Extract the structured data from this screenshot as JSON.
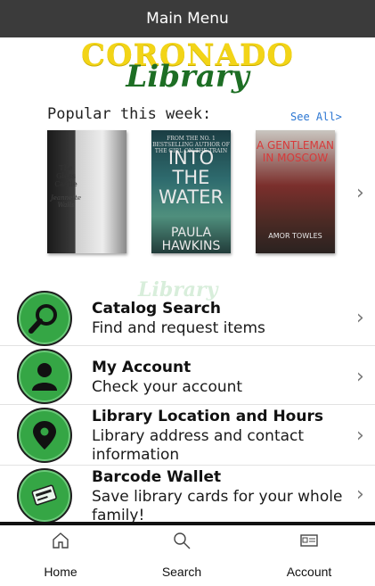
{
  "header": {
    "title": "Main Menu"
  },
  "logo": {
    "line1": "CORONADO",
    "line2": "Library"
  },
  "popular": {
    "title": "Popular this week:",
    "see_all": "See All>",
    "books": [
      {
        "title": "The Glass Castle",
        "author": "Jeannette Walls"
      },
      {
        "top": "FROM THE NO. 1 BESTSELLING AUTHOR OF THE GIRL ON THE TRAIN",
        "title": "INTO THE WATER",
        "author": "PAULA HAWKINS"
      },
      {
        "title": "A GENTLEMAN IN MOSCOW",
        "author": "AMOR TOWLES"
      }
    ]
  },
  "watermark": "Library",
  "menu": [
    {
      "title": "Catalog Search",
      "subtitle": "Find and request items",
      "icon": "magnifier-icon"
    },
    {
      "title": "My Account",
      "subtitle": "Check your account",
      "icon": "person-icon"
    },
    {
      "title": "Library Location and Hours",
      "subtitle": "Library address and contact information",
      "icon": "map-pin-icon"
    },
    {
      "title": "Barcode Wallet",
      "subtitle": "Save library cards for your whole family!",
      "icon": "library-card-icon"
    }
  ],
  "bottom_nav": [
    {
      "label": "Home",
      "icon": "home-icon"
    },
    {
      "label": "Search",
      "icon": "search-icon"
    },
    {
      "label": "Account",
      "icon": "id-card-icon"
    }
  ],
  "colors": {
    "title_bar": "#3b3b3b",
    "accent_green": "#35a645",
    "logo_yellow": "#f2d417",
    "logo_green": "#1d6e24",
    "link_blue": "#2b76d2"
  }
}
